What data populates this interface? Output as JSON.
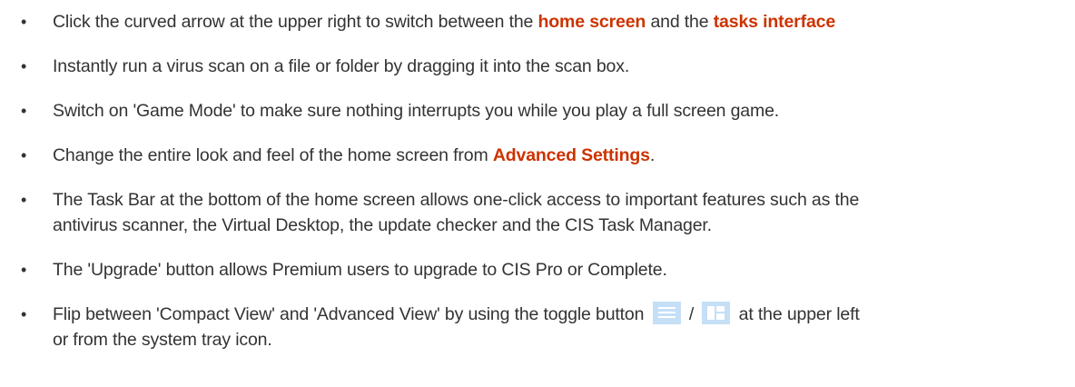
{
  "bullet_glyph": "•",
  "tips": [
    {
      "before": "Click the curved arrow at the upper right to switch between the ",
      "link1": "home screen",
      "between": " and the ",
      "link2": "tasks interface"
    },
    {
      "text": "Instantly run a virus scan on a file or folder by dragging it into the scan box."
    },
    {
      "text": "Switch on 'Game Mode' to make sure nothing interrupts you while you play a full screen game."
    },
    {
      "before": "Change the entire look and feel of the home screen from ",
      "link": "Advanced Settings",
      "after": "."
    },
    {
      "line1": "The Task Bar at the bottom of the home screen allows one-click access to important features such as the",
      "line2": "antivirus scanner, the Virtual Desktop, the update checker and the CIS Task Manager."
    },
    {
      "text": "The 'Upgrade' button allows Premium users to upgrade to CIS Pro or Complete."
    },
    {
      "before": "Flip between 'Compact View' and 'Advanced View' by using the toggle button ",
      "separator": " / ",
      "after_line1": " at the upper left",
      "after_line2": "or from the system tray icon."
    }
  ],
  "colors": {
    "text": "#333333",
    "link": "#cc3300",
    "toggle_icon_bg": "#c5dff6"
  },
  "icons": [
    "compact-view-icon",
    "advanced-view-icon"
  ]
}
